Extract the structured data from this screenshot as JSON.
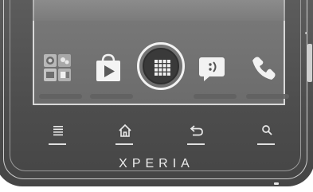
{
  "device": {
    "brand": "XPERIA",
    "body_color": "#505050",
    "screen_color": "#727272",
    "accent_color": "#ffffff"
  },
  "home_screen": {
    "dock_icons": [
      {
        "name": "widget-folder-icon"
      },
      {
        "name": "play-store-icon"
      },
      {
        "name": "apps-grid-icon",
        "highlighted": true
      },
      {
        "name": "messaging-icon"
      },
      {
        "name": "phone-icon"
      }
    ]
  },
  "nav_bar": [
    {
      "name": "menu-icon"
    },
    {
      "name": "home-icon"
    },
    {
      "name": "back-icon"
    },
    {
      "name": "search-icon"
    }
  ]
}
